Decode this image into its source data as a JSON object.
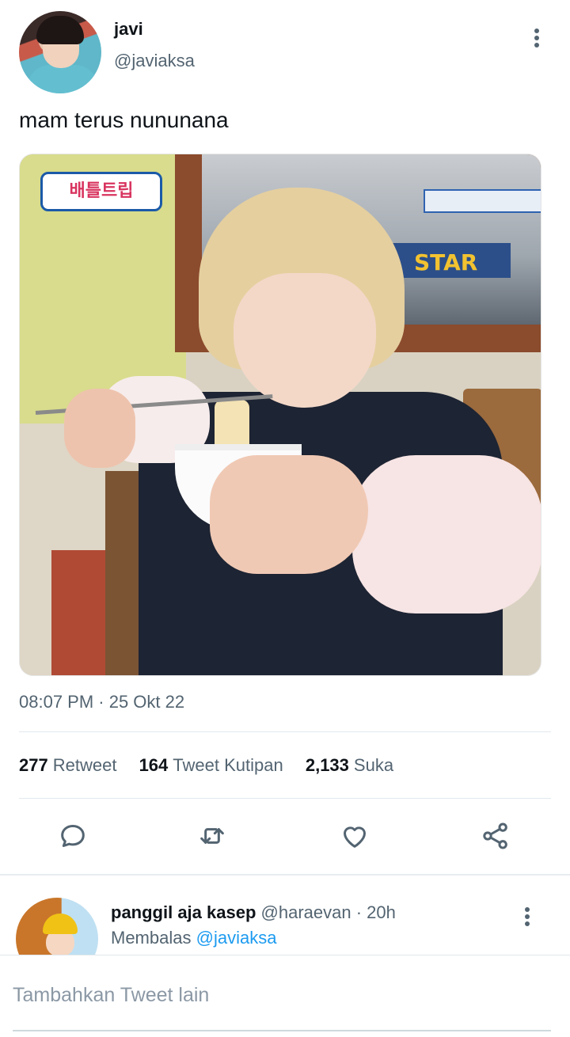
{
  "tweet": {
    "display_name": "javi",
    "handle": "@javiaksa",
    "text": "mam terus nununana",
    "timestamp": "08:07 PM · 25 Okt 22",
    "media": {
      "logo_text": "배틀트립",
      "sign_text": "STAR"
    },
    "stats": [
      {
        "count": "277",
        "label": "Retweet"
      },
      {
        "count": "164",
        "label": "Tweet Kutipan"
      },
      {
        "count": "2,133",
        "label": "Suka"
      }
    ],
    "actions": [
      "reply-icon",
      "retweet-icon",
      "like-icon",
      "share-icon"
    ]
  },
  "reply": {
    "name": "panggil aja kasep",
    "meta": "@haraevan · 20h",
    "replying_prefix": "Membalas",
    "replying_to": "@javiaksa"
  },
  "compose": {
    "placeholder": "Tambahkan Tweet lain"
  },
  "colors": {
    "text": "#0f1419",
    "secondary": "#536471",
    "accent": "#1d9bf0",
    "divider": "#e1e8ed"
  }
}
